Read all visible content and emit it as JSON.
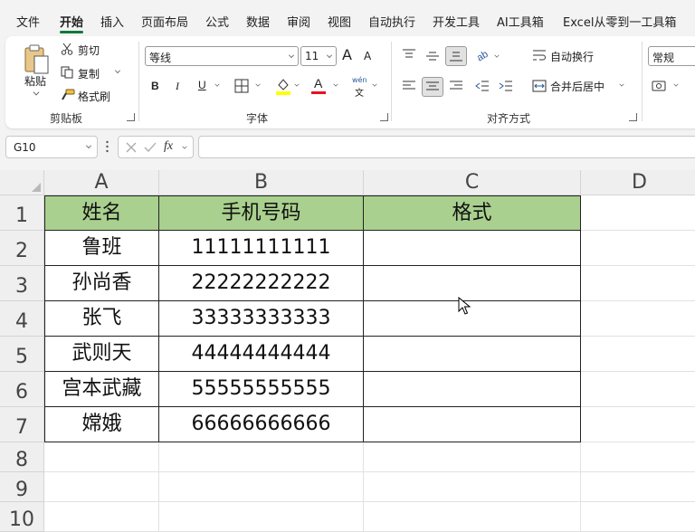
{
  "menu": {
    "tabs": [
      "文件",
      "开始",
      "插入",
      "页面布局",
      "公式",
      "数据",
      "审阅",
      "视图",
      "自动执行",
      "开发工具",
      "AI工具箱",
      "Excel从零到一工具箱"
    ],
    "active": "开始"
  },
  "ribbon": {
    "clipboard": {
      "paste": "粘贴",
      "cut": "剪切",
      "copy": "复制",
      "format_painter": "格式刷",
      "label": "剪贴板"
    },
    "font": {
      "name": "等线",
      "size": "11",
      "label": "字体",
      "bold": "B",
      "italic": "I",
      "underline": "U",
      "grow": "A",
      "shrink": "A",
      "phonetic_top": "wén",
      "phonetic_bottom": "文",
      "font_color_letter": "A"
    },
    "alignment": {
      "wrap": "自动换行",
      "merge": "合并后居中",
      "label": "对齐方式"
    },
    "number": {
      "format": "常规"
    },
    "colors": {
      "accent": "#117a3b",
      "fill": "#ffff00",
      "font_color": "#e81123"
    }
  },
  "formula_bar": {
    "name_box": "G10",
    "fx": "fx",
    "value": ""
  },
  "sheet": {
    "columns": [
      "A",
      "B",
      "C",
      "D"
    ],
    "rows": [
      "1",
      "2",
      "3",
      "4",
      "5",
      "6",
      "7",
      "8",
      "9",
      "10"
    ],
    "headers": [
      "姓名",
      "手机号码",
      "格式"
    ],
    "header_fill": "#a9d08e",
    "data": [
      [
        "鲁班",
        "11111111111",
        ""
      ],
      [
        "孙尚香",
        "22222222222",
        ""
      ],
      [
        "张飞",
        "33333333333",
        ""
      ],
      [
        "武则天",
        "44444444444",
        ""
      ],
      [
        "宫本武藏",
        "55555555555",
        ""
      ],
      [
        "嫦娥",
        "66666666666",
        ""
      ]
    ]
  }
}
